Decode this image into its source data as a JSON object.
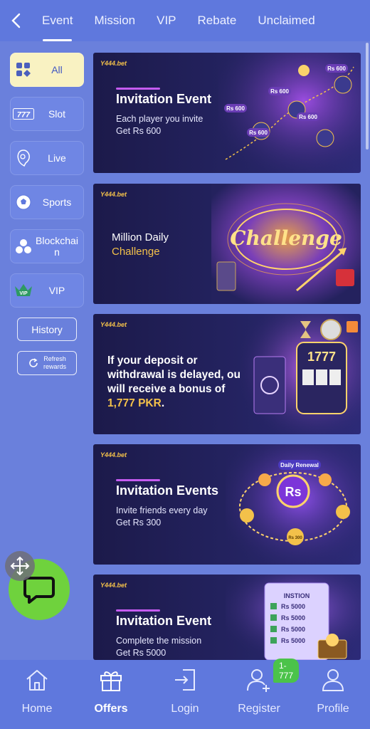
{
  "tabs": [
    {
      "label": "Event",
      "active": true
    },
    {
      "label": "Mission"
    },
    {
      "label": "VIP"
    },
    {
      "label": "Rebate"
    },
    {
      "label": "Unclaimed"
    }
  ],
  "categories": [
    {
      "label": "All",
      "icon": "grid-icon",
      "active": true
    },
    {
      "label": "Slot",
      "icon": "slot-777-icon"
    },
    {
      "label": "Live",
      "icon": "live-dealer-icon"
    },
    {
      "label": "Sports",
      "icon": "soccer-ball-icon"
    },
    {
      "label": "Blockchain",
      "icon": "blockchain-icon"
    },
    {
      "label": "VIP",
      "icon": "vip-badge-icon"
    }
  ],
  "sidebar_actions": {
    "history": "History",
    "refresh": "Refresh rewards"
  },
  "banners": [
    {
      "brand": "Y444.bet",
      "title": "Invitation Event",
      "lines": [
        "Each player you invite",
        "Get Rs 600"
      ],
      "art_labels": [
        "Rs 600",
        "Rs 600",
        "Rs 600",
        "Rs 600",
        "Rs 600"
      ]
    },
    {
      "brand": "Y444.bet",
      "text_line1": "Million Daily",
      "text_line2": "Challenge",
      "art_word": "Challenge"
    },
    {
      "brand": "Y444.bet",
      "message_main": "If your deposit or withdrawal is delayed, ou will receive a bonus of ",
      "message_amount": "1,777 PKR",
      "message_end": ".",
      "art_number": "1777"
    },
    {
      "brand": "Y444.bet",
      "title": "Invitation Events",
      "lines": [
        "Invite friends every day",
        "Get Rs 300"
      ],
      "art_ribbon": "Daily Renewal",
      "art_coin": "Rs",
      "art_chip": "Rs 300"
    },
    {
      "brand": "Y444.bet",
      "title": "Invitation Event",
      "lines": [
        "Complete the mission",
        "Get Rs 5000"
      ],
      "art_heading": "INSTION",
      "art_items": [
        "Rs 5000",
        "Rs 5000",
        "Rs 5000",
        "Rs 5000"
      ]
    }
  ],
  "bottom_nav": [
    {
      "label": "Home",
      "icon": "home-icon"
    },
    {
      "label": "Offers",
      "icon": "gift-icon",
      "active": true
    },
    {
      "label": "Login",
      "icon": "login-icon"
    },
    {
      "label": "Register",
      "icon": "add-user-icon",
      "badge": "1-777"
    },
    {
      "label": "Profile",
      "icon": "user-icon"
    }
  ],
  "colors": {
    "accent": "#5f78dd",
    "background": "#6a80dc",
    "active_category": "#f9f2c2",
    "highlight_gold": "#f3c14a",
    "chat_green": "#6fd23d"
  }
}
